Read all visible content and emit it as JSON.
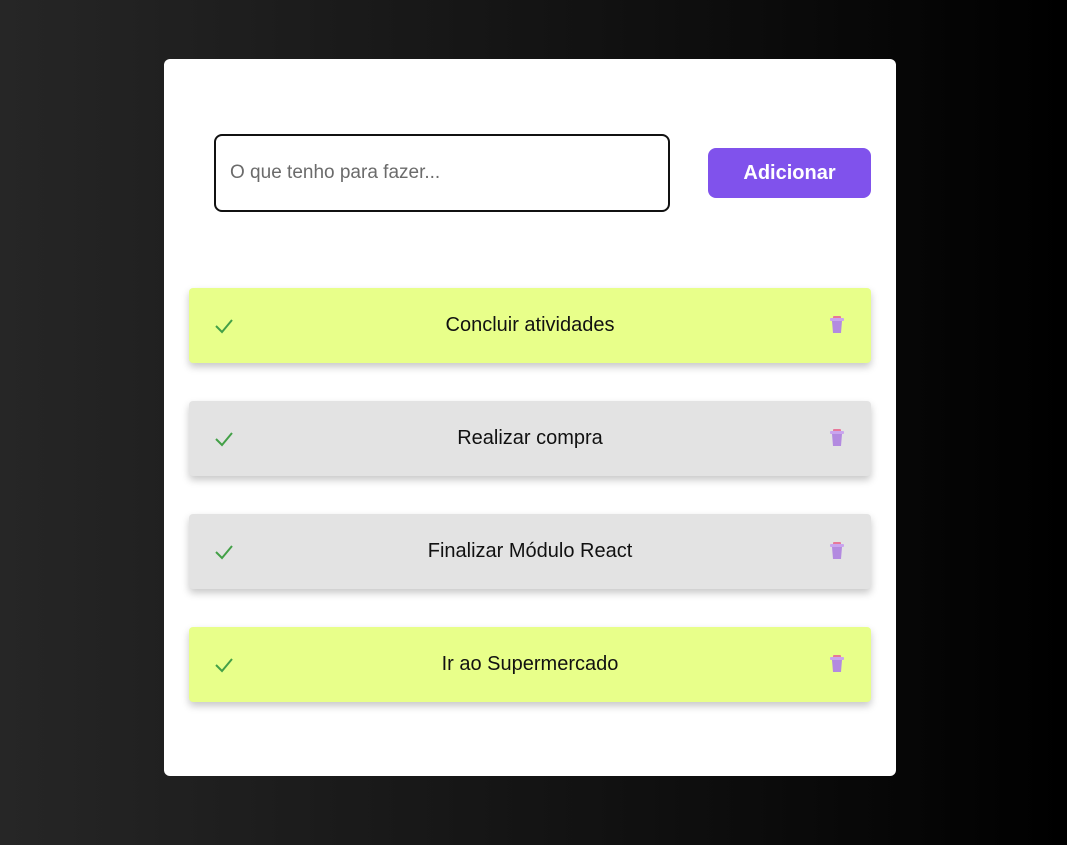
{
  "input": {
    "placeholder": "O que tenho para fazer...",
    "value": ""
  },
  "add_button_label": "Adicionar",
  "colors": {
    "accent": "#8052ec",
    "done_bg": "#e8ff8a",
    "pending_bg": "#e3e3e3",
    "check": "#43a047",
    "trash": "#b38ae0"
  },
  "tasks": [
    {
      "label": "Concluir atividades",
      "status": "done",
      "check_icon": "check-icon",
      "delete_icon": "trash-icon"
    },
    {
      "label": "Realizar compra",
      "status": "pending",
      "check_icon": "check-icon",
      "delete_icon": "trash-icon"
    },
    {
      "label": "Finalizar Módulo React",
      "status": "pending",
      "check_icon": "check-icon",
      "delete_icon": "trash-icon"
    },
    {
      "label": "Ir ao Supermercado",
      "status": "done",
      "check_icon": "check-icon",
      "delete_icon": "trash-icon"
    }
  ]
}
